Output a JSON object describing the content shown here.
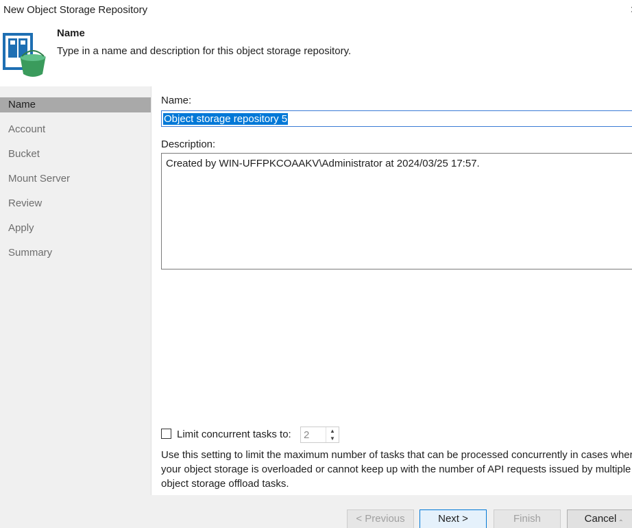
{
  "window": {
    "title": "New Object Storage Repository",
    "close_glyph": "›"
  },
  "header": {
    "icon": "object-storage-repository-icon",
    "title": "Name",
    "description": "Type in a name and description for this object storage repository."
  },
  "sidebar": {
    "items": [
      {
        "label": "Name",
        "active": true
      },
      {
        "label": "Account",
        "active": false
      },
      {
        "label": "Bucket",
        "active": false
      },
      {
        "label": "Mount Server",
        "active": false
      },
      {
        "label": "Review",
        "active": false
      },
      {
        "label": "Apply",
        "active": false
      },
      {
        "label": "Summary",
        "active": false
      }
    ]
  },
  "form": {
    "name_label": "Name:",
    "name_value": "Object storage repository 5",
    "description_label": "Description:",
    "description_value": "Created by WIN-UFFPKCOAAKV\\Administrator at 2024/03/25 17:57.",
    "limit_checkbox_checked": false,
    "limit_label": "Limit concurrent tasks to:",
    "limit_value": "2",
    "help_lines": [
      "Use this setting to limit the maximum number of tasks that can be processed concurrently in cases wher",
      "your object storage is overloaded or cannot keep up with the number of API requests issued by multiple",
      "object storage offload tasks."
    ]
  },
  "footer": {
    "previous_label": "< Previous",
    "next_label": "Next >",
    "finish_label": "Finish",
    "cancel_label": "Cancel"
  },
  "colors": {
    "accent": "#0078d7",
    "sidebar_bg": "#f0f0f0",
    "sidebar_active": "#a9a9a9",
    "bucket_green": "#3a9b5c",
    "server_blue": "#1e6fb3"
  }
}
